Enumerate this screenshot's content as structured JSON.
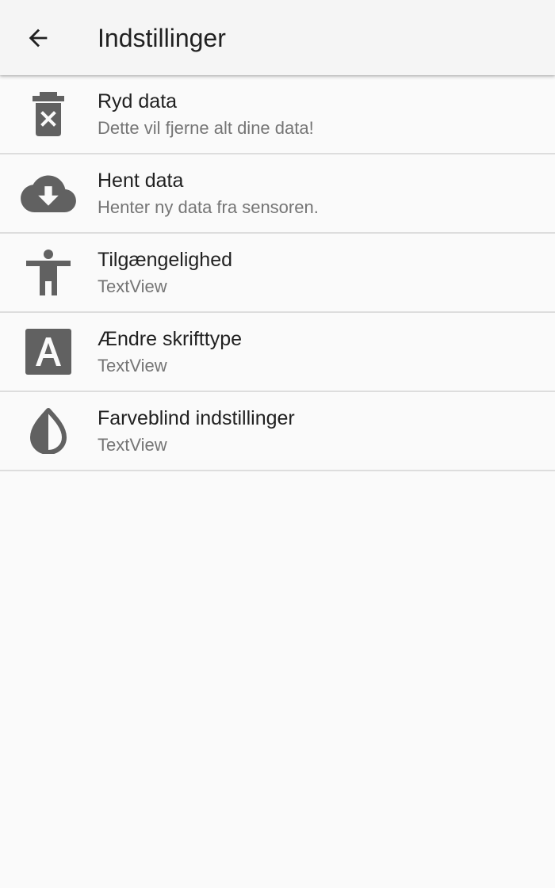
{
  "toolbar": {
    "back_icon": "arrow-back-icon",
    "title": "Indstillinger"
  },
  "settings": [
    {
      "icon": "trash-x-icon",
      "title": "Ryd data",
      "subtitle": "Dette vil fjerne alt dine data!"
    },
    {
      "icon": "cloud-download-icon",
      "title": "Hent data",
      "subtitle": "Henter ny data fra sensoren."
    },
    {
      "icon": "accessibility-icon",
      "title": "Tilgængelighed",
      "subtitle": "TextView"
    },
    {
      "icon": "font-letter-a-icon",
      "title": "Ændre skrifttype",
      "subtitle": "TextView"
    },
    {
      "icon": "color-drop-icon",
      "title": "Farveblind indstillinger",
      "subtitle": "TextView"
    }
  ],
  "colors": {
    "icon": "#616161",
    "title_text": "#212121",
    "subtitle_text": "#757575",
    "toolbar_bg": "#f5f5f5",
    "background": "#fafafa",
    "divider": "#dddddd"
  }
}
